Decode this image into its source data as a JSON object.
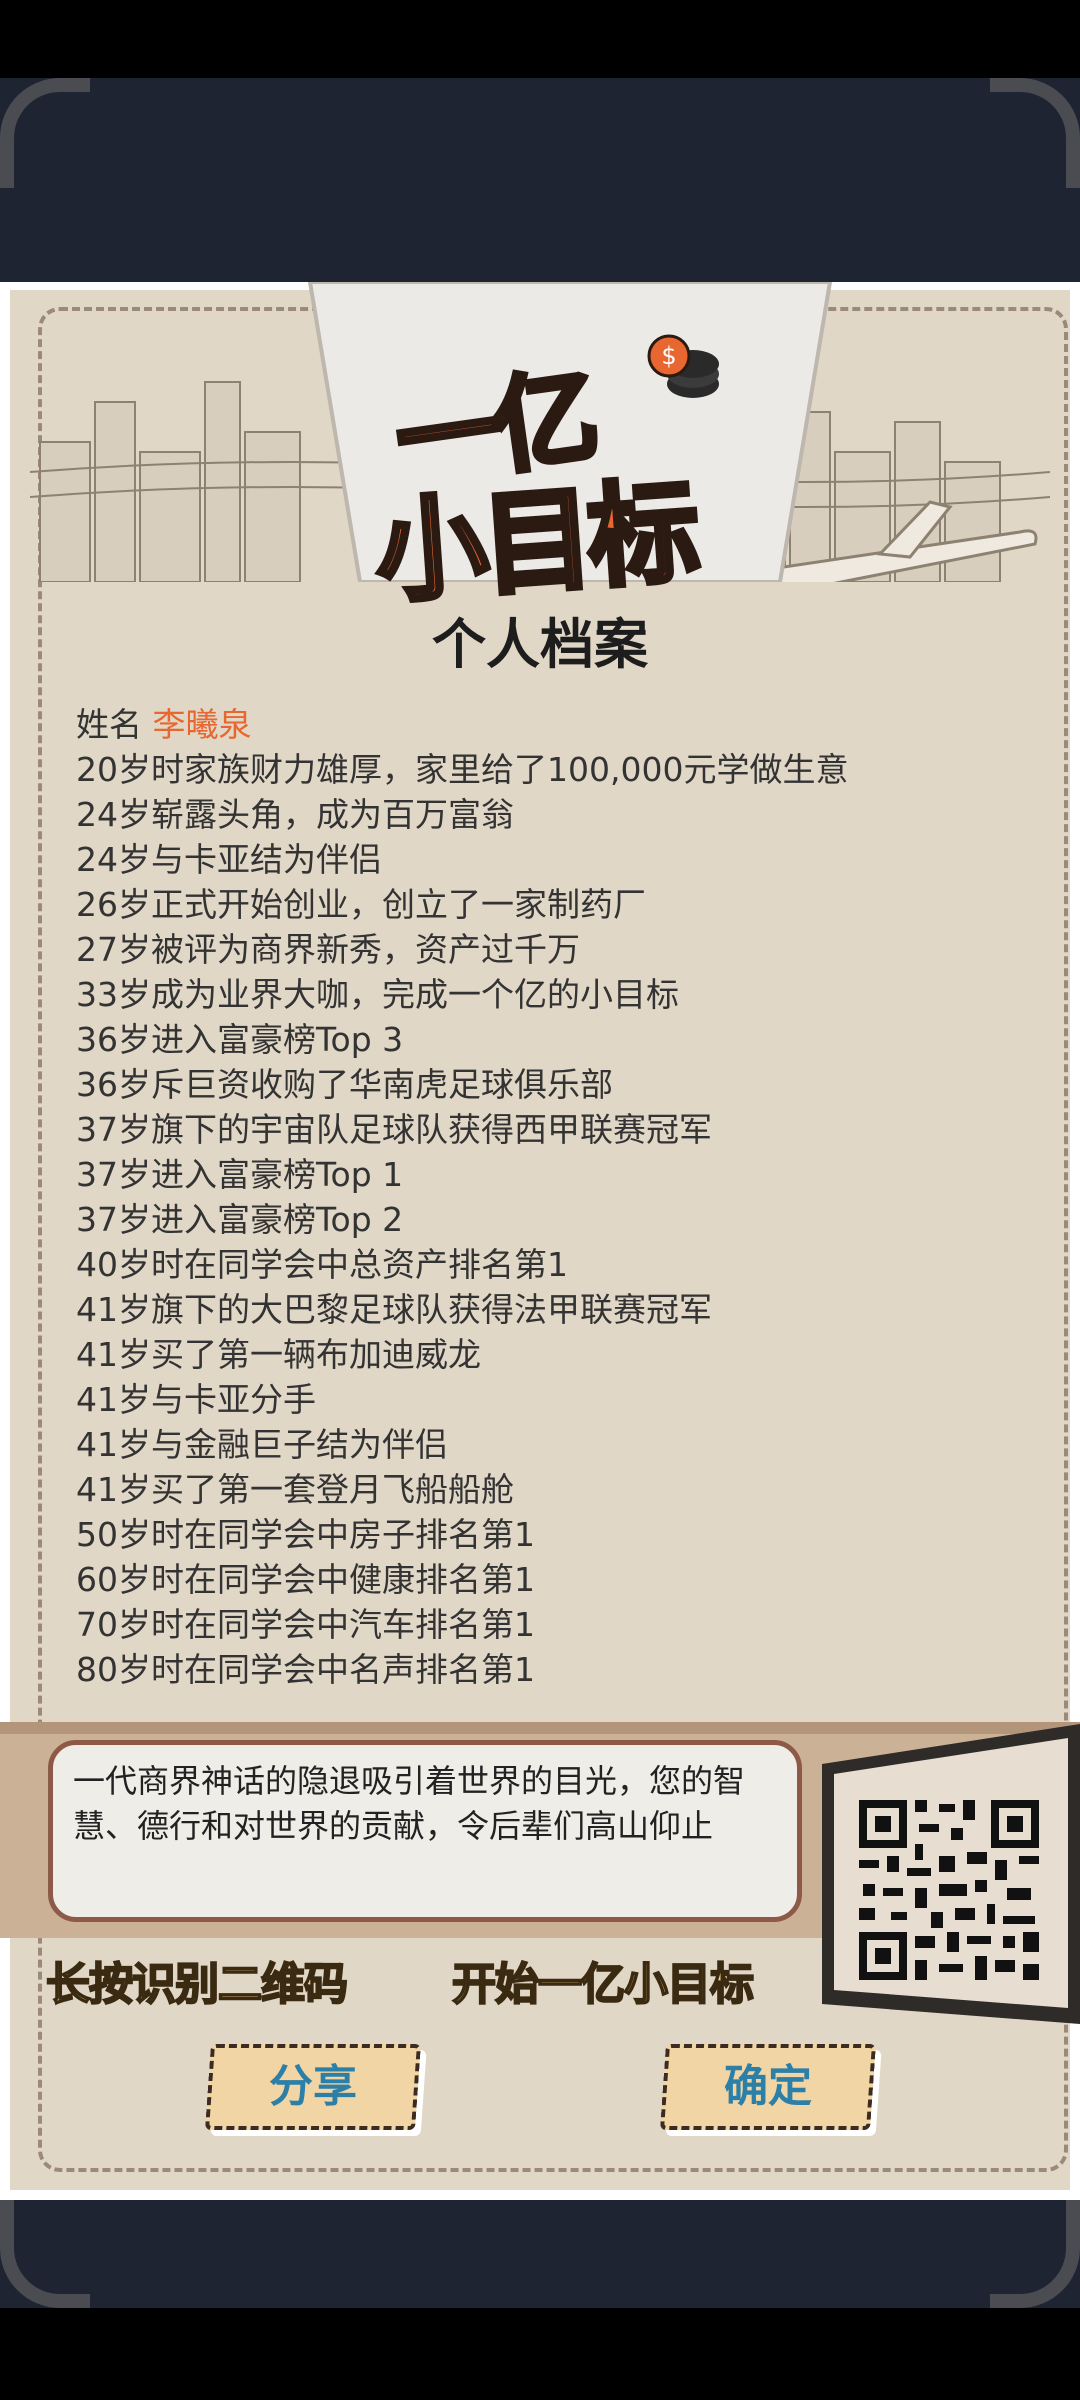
{
  "logo": {
    "line1": "一亿",
    "line2": "小目标"
  },
  "title": "个人档案",
  "name_label": "姓名",
  "name_value": "李曦泉",
  "entries": [
    "20岁时家族财力雄厚，家里给了100,000元学做生意",
    "24岁崭露头角，成为百万富翁",
    "24岁与卡亚结为伴侣",
    "26岁正式开始创业，创立了一家制药厂",
    "27岁被评为商界新秀，资产过千万",
    "33岁成为业界大咖，完成一个亿的小目标",
    "36岁进入富豪榜Top 3",
    "36岁斥巨资收购了华南虎足球俱乐部",
    "37岁旗下的宇宙队足球队获得西甲联赛冠军",
    "37岁进入富豪榜Top 1",
    "37岁进入富豪榜Top 2",
    "40岁时在同学会中总资产排名第1",
    "41岁旗下的大巴黎足球队获得法甲联赛冠军",
    "41岁买了第一辆布加迪威龙",
    "41岁与卡亚分手",
    "41岁与金融巨子结为伴侣",
    "41岁买了第一套登月飞船船舱",
    "50岁时在同学会中房子排名第1",
    "60岁时在同学会中健康排名第1",
    "70岁时在同学会中汽车排名第1",
    "80岁时在同学会中名声排名第1"
  ],
  "summary": "一代商界神话的隐退吸引着世界的目光，您的智慧、德行和对世界的贡献，令后辈们高山仰止",
  "qr_hint": "长按识别二维码",
  "start_text": "开始一亿小目标",
  "buttons": {
    "share": "分享",
    "confirm": "确定"
  },
  "colors": {
    "accent": "#e8662f",
    "paper": "#e1d7c7",
    "frame": "#1f2433",
    "button_text": "#2c7fa6",
    "yellow_text": "#f6d07c"
  }
}
